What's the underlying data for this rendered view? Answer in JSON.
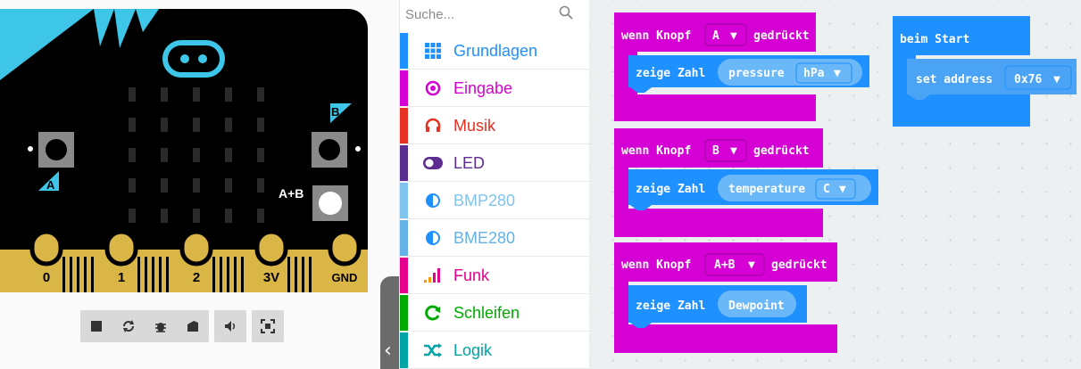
{
  "simulator": {
    "pins": [
      "0",
      "1",
      "2",
      "3V",
      "GND"
    ],
    "button_a_label": "A",
    "button_b_label": "B",
    "button_ab_label": "A+B",
    "toolbar": [
      "stop-icon",
      "restart-icon",
      "debug-icon",
      "screenshot-icon",
      "sound-icon",
      "fullscreen-icon"
    ]
  },
  "toolbox": {
    "search_placeholder": "Suche...",
    "categories": [
      {
        "label": "Grundlagen",
        "color": "#1e90ff",
        "icon": "grid-icon"
      },
      {
        "label": "Eingabe",
        "color": "#d400d4",
        "icon": "target-icon"
      },
      {
        "label": "Musik",
        "color": "#e63022",
        "icon": "headphones-icon"
      },
      {
        "label": "LED",
        "color": "#5c2d91",
        "icon": "toggle-icon"
      },
      {
        "label": "BMP280",
        "color": "#7fc4ee",
        "icon": "half-circle-icon"
      },
      {
        "label": "BME280",
        "color": "#65b2e8",
        "icon": "half-circle-icon"
      },
      {
        "label": "Funk",
        "color": "#e3008c",
        "icon": "signal-bars-icon"
      },
      {
        "label": "Schleifen",
        "color": "#00aa00",
        "icon": "loop-icon"
      },
      {
        "label": "Logik",
        "color": "#00a4a6",
        "icon": "shuffle-icon"
      }
    ]
  },
  "workspace": {
    "event_color": "#d400d4",
    "block_color": "#1e90ff",
    "events": [
      {
        "prefix": "wenn Knopf",
        "button": "A",
        "suffix": "gedrückt",
        "action": "zeige Zahl",
        "value": "pressure",
        "unit": "hPa"
      },
      {
        "prefix": "wenn Knopf",
        "button": "B",
        "suffix": "gedrückt",
        "action": "zeige Zahl",
        "value": "temperature",
        "unit": "C"
      },
      {
        "prefix": "wenn Knopf",
        "button": "A+B",
        "suffix": "gedrückt",
        "action": "zeige Zahl",
        "value": "Dewpoint"
      }
    ],
    "on_start": {
      "title": "beim Start",
      "action": "set address",
      "address": "0x76"
    }
  }
}
